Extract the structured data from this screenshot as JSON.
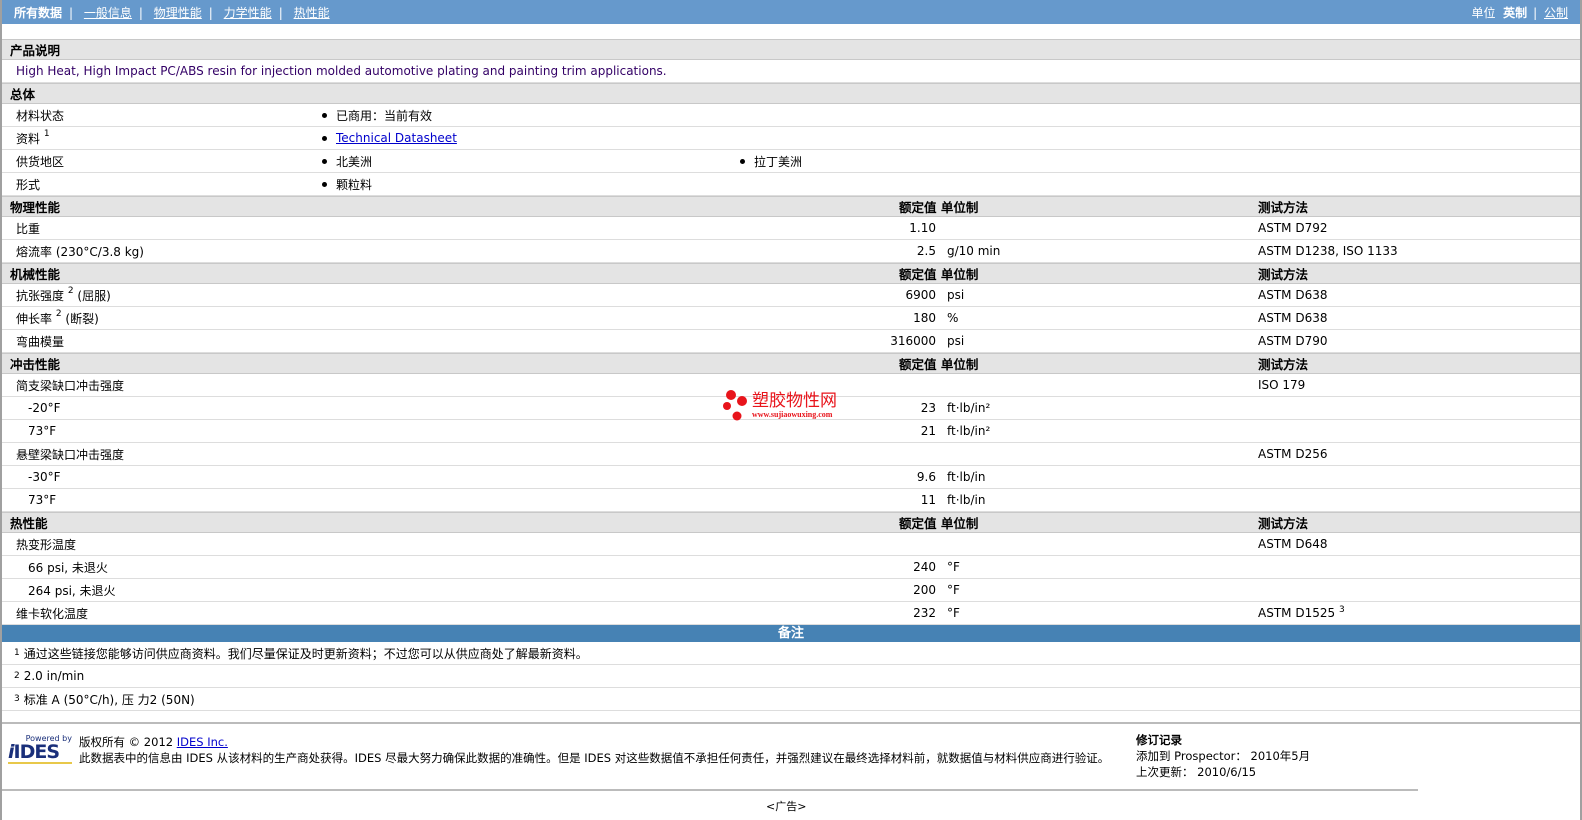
{
  "nav": {
    "tabs": [
      "所有数据",
      "一般信息",
      "物理性能",
      "力学性能",
      "热性能"
    ],
    "units_label": "单位",
    "unit_active": "英制",
    "unit_other": "公制"
  },
  "product": {
    "header": "产品说明",
    "description": "High Heat, High Impact PC/ABS resin for injection molded automotive plating and painting trim applications."
  },
  "general": {
    "header": "总体",
    "rows": [
      {
        "label": "材料状态",
        "values": [
          "已商用：当前有效"
        ]
      },
      {
        "label": "资料",
        "sup": "1",
        "link": "Technical Datasheet"
      },
      {
        "label": "供货地区",
        "values": [
          "北美洲",
          "拉丁美洲"
        ]
      },
      {
        "label": "形式",
        "values": [
          "颗粒料"
        ]
      }
    ]
  },
  "col_headers": {
    "value": "额定值 单位制",
    "test": "测试方法"
  },
  "sections": [
    {
      "header": "物理性能",
      "rows": [
        {
          "label": "比重",
          "value": "1.10",
          "unit": "",
          "test": "ASTM D792"
        },
        {
          "label": "熔流率 (230°C/3.8 kg)",
          "value": "2.5",
          "unit": "g/10 min",
          "test": "ASTM D1238, ISO 1133"
        }
      ]
    },
    {
      "header": "机械性能",
      "rows": [
        {
          "label": "抗张强度",
          "sup": "2",
          "suffix": "(屈服)",
          "value": "6900",
          "unit": "psi",
          "test": "ASTM D638"
        },
        {
          "label": "伸长率",
          "sup": "2",
          "suffix": "(断裂)",
          "value": "180",
          "unit": "%",
          "test": "ASTM D638"
        },
        {
          "label": "弯曲模量",
          "value": "316000",
          "unit": "psi",
          "test": "ASTM D790"
        }
      ]
    },
    {
      "header": "冲击性能",
      "rows": [
        {
          "label": "简支梁缺口冲击强度",
          "value": "",
          "unit": "",
          "test": "ISO 179"
        },
        {
          "label": "-20°F",
          "sub": true,
          "value": "23",
          "unit": "ft·lb/in²",
          "test": ""
        },
        {
          "label": "73°F",
          "sub": true,
          "value": "21",
          "unit": "ft·lb/in²",
          "test": ""
        },
        {
          "label": "悬壁梁缺口冲击强度",
          "value": "",
          "unit": "",
          "test": "ASTM D256"
        },
        {
          "label": "-30°F",
          "sub": true,
          "value": "9.6",
          "unit": "ft·lb/in",
          "test": ""
        },
        {
          "label": "73°F",
          "sub": true,
          "value": "11",
          "unit": "ft·lb/in",
          "test": ""
        }
      ]
    },
    {
      "header": "热性能",
      "rows": [
        {
          "label": "热变形温度",
          "value": "",
          "unit": "",
          "test": "ASTM D648"
        },
        {
          "label": "66 psi, 未退火",
          "sub": true,
          "value": "240",
          "unit": "°F",
          "test": ""
        },
        {
          "label": "264 psi, 未退火",
          "sub": true,
          "value": "200",
          "unit": "°F",
          "test": ""
        },
        {
          "label": "维卡软化温度",
          "value": "232",
          "unit": "°F",
          "test": "ASTM D1525",
          "test_sup": "3"
        }
      ]
    }
  ],
  "notes": {
    "header": "备注",
    "items": [
      {
        "num": "1",
        "text": "通过这些链接您能够访问供应商资料。我们尽量保证及时更新资料；不过您可以从供应商处了解最新资料。"
      },
      {
        "num": "2",
        "text": "2.0 in/min"
      },
      {
        "num": "3",
        "text": "标准  A (50°C/h), 压  力2 (50N)"
      }
    ]
  },
  "watermark": {
    "text": "塑胶物性网",
    "url": "www.sujiaowuxing.com"
  },
  "footer": {
    "logo_small": "Powered by",
    "logo": "IDES",
    "copyright": "版权所有  © 2012",
    "company_link": "IDES Inc.",
    "disclaimer": "此数据表中的信息由  IDES 从该材料的生产商处获得。IDES 尽最大努力确保此数据的准确性。但是  IDES 对这些数据值不承担任何责任，并强烈建议在最终选择材料前，就数据值与材料供应商进行验证。",
    "revision_title": "修订记录",
    "added_label": "添加到  Prospector：",
    "added_value": "2010年5月",
    "updated_label": "上次更新：",
    "updated_value": "2010/6/15",
    "ad": "<广告>"
  },
  "colors": {
    "topbar": "#6699cc",
    "notes": "#4682b4",
    "section": "#e4e4e4"
  }
}
